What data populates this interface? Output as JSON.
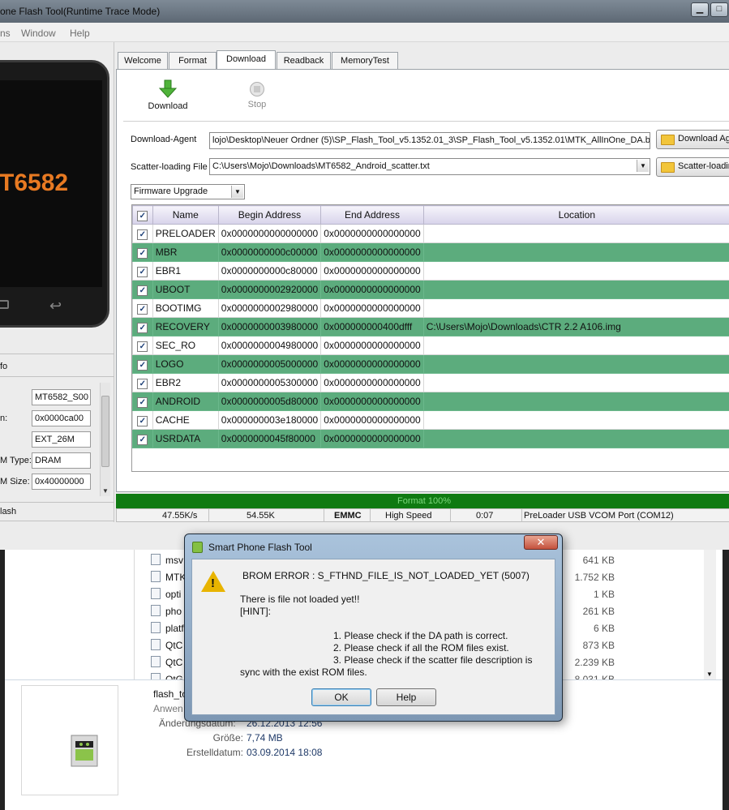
{
  "window": {
    "title": "one Flash Tool(Runtime Trace Mode)",
    "controls": {
      "minimize": "▁",
      "maximize": "□"
    }
  },
  "menu": [
    "ns",
    "Window",
    "Help"
  ],
  "left_panel": {
    "phone_model": "T6582",
    "info_label": "fo",
    "fields": [
      {
        "label": "",
        "value": "MT6582_S00"
      },
      {
        "label": "n:",
        "value": "0x0000ca00"
      },
      {
        "label": "",
        "value": "EXT_26M"
      },
      {
        "label": "M Type:",
        "value": "DRAM"
      },
      {
        "label": "M Size:",
        "value": "0x40000000"
      }
    ],
    "bottom_label": "lash"
  },
  "tabs": [
    "Welcome",
    "Format",
    "Download",
    "Readback",
    "MemoryTest"
  ],
  "active_tab": "Download",
  "toolbar": {
    "download": "Download",
    "stop": "Stop"
  },
  "download_agent": {
    "label": "Download-Agent",
    "path": "lojo\\Desktop\\Neuer Ordner (5)\\SP_Flash_Tool_v5.1352.01_3\\SP_Flash_Tool_v5.1352.01\\MTK_AllInOne_DA.bin",
    "button": "Download Ag"
  },
  "scatter": {
    "label": "Scatter-loading File",
    "path": "C:\\Users\\Mojo\\Downloads\\MT6582_Android_scatter.txt",
    "button": "Scatter-loadin"
  },
  "mode_select": "Firmware Upgrade",
  "table": {
    "headers": [
      "",
      "Name",
      "Begin Address",
      "End Address",
      "Location"
    ],
    "rows": [
      {
        "name": "PRELOADER",
        "begin": "0x0000000000000000",
        "end": "0x0000000000000000",
        "location": ""
      },
      {
        "name": "MBR",
        "begin": "0x0000000000c00000",
        "end": "0x0000000000000000",
        "location": ""
      },
      {
        "name": "EBR1",
        "begin": "0x0000000000c80000",
        "end": "0x0000000000000000",
        "location": ""
      },
      {
        "name": "UBOOT",
        "begin": "0x0000000002920000",
        "end": "0x0000000000000000",
        "location": ""
      },
      {
        "name": "BOOTIMG",
        "begin": "0x0000000002980000",
        "end": "0x0000000000000000",
        "location": ""
      },
      {
        "name": "RECOVERY",
        "begin": "0x0000000003980000",
        "end": "0x000000000400dfff",
        "location": "C:\\Users\\Mojo\\Downloads\\CTR 2.2 A106.img"
      },
      {
        "name": "SEC_RO",
        "begin": "0x0000000004980000",
        "end": "0x0000000000000000",
        "location": ""
      },
      {
        "name": "LOGO",
        "begin": "0x0000000005000000",
        "end": "0x0000000000000000",
        "location": ""
      },
      {
        "name": "EBR2",
        "begin": "0x0000000005300000",
        "end": "0x0000000000000000",
        "location": ""
      },
      {
        "name": "ANDROID",
        "begin": "0x0000000005d80000",
        "end": "0x0000000000000000",
        "location": ""
      },
      {
        "name": "CACHE",
        "begin": "0x000000003e180000",
        "end": "0x0000000000000000",
        "location": ""
      },
      {
        "name": "USRDATA",
        "begin": "0x0000000045f80000",
        "end": "0x0000000000000000",
        "location": ""
      }
    ]
  },
  "progress": {
    "label": "Format 100%",
    "percent": 100
  },
  "status": {
    "speed": "47.55K/s",
    "size": "54.55K",
    "storage": "EMMC",
    "usb": "High Speed",
    "time": "0:07",
    "port": "PreLoader USB VCOM Port (COM12)"
  },
  "explorer": {
    "files": [
      {
        "name": "msv",
        "size": "641 KB"
      },
      {
        "name": "MTK",
        "size": "1.752 KB"
      },
      {
        "name": "opti",
        "size": "1 KB"
      },
      {
        "name": "pho",
        "size": "261 KB"
      },
      {
        "name": "platf",
        "size": "6 KB"
      },
      {
        "name": "QtC",
        "size": "873 KB"
      },
      {
        "name": "QtC",
        "size": "2.239 KB"
      },
      {
        "name": "QtG",
        "size": "8.031 KB"
      }
    ],
    "details": {
      "filename": "flash_to",
      "type": "Anwen",
      "rows": [
        {
          "label": "Änderungsdatum:",
          "value": "26.12.2013 12:56"
        },
        {
          "label": "Größe:",
          "value": "7,74 MB"
        },
        {
          "label": "Erstelldatum:",
          "value": "03.09.2014 18:08"
        }
      ]
    }
  },
  "dialog": {
    "title": "Smart Phone Flash Tool",
    "close": "✕",
    "error": "BROM ERROR : S_FTHND_FILE_IS_NOT_LOADED_YET (5007)",
    "line1": "There is file not loaded yet!!",
    "line2": "[HINT]:",
    "hint1": "1. Please check if the DA path is correct.",
    "hint2": "2. Please check if all the ROM files exist.",
    "hint3": "3. Please check if the scatter file description is",
    "hint4": "sync with the exist ROM files.",
    "ok": "OK",
    "help": "Help"
  }
}
